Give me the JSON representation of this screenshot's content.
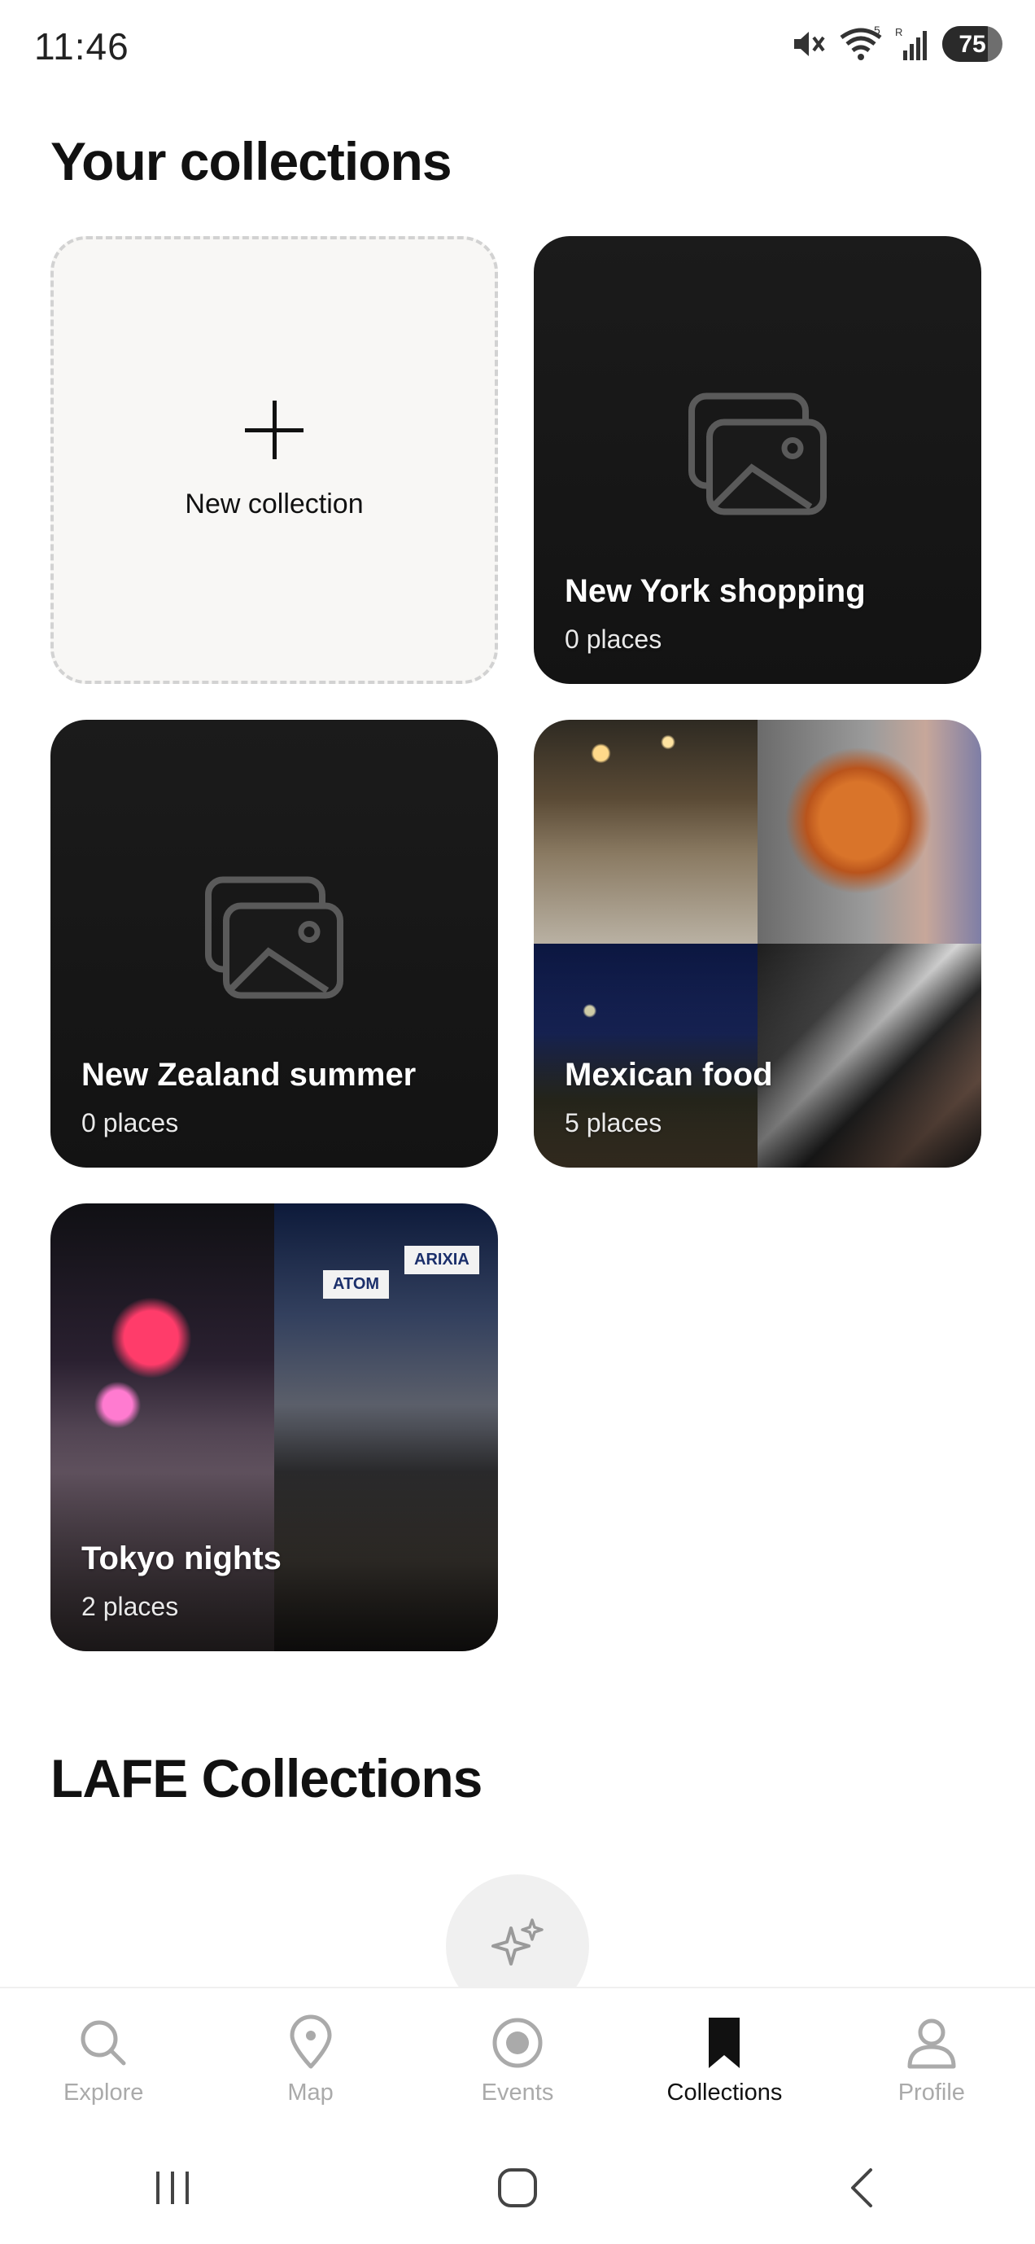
{
  "status_bar": {
    "time": "11:46",
    "battery": "75",
    "signal_label": "5",
    "roaming_label": "R"
  },
  "collections_section": {
    "title": "Your collections",
    "new_collection_label": "New collection",
    "items": [
      {
        "title": "New York shopping",
        "count": "0 places",
        "has_photos": false
      },
      {
        "title": "New Zealand summer",
        "count": "0 places",
        "has_photos": false
      },
      {
        "title": "Mexican food",
        "count": "5 places",
        "has_photos": true
      },
      {
        "title": "Tokyo nights",
        "count": "2 places",
        "has_photos": true
      }
    ],
    "tokyo_signs": [
      "ATOM",
      "ARIXIA"
    ]
  },
  "lafe_section": {
    "title": "LAFE Collections"
  },
  "bottom_nav": {
    "items": [
      {
        "label": "Explore",
        "icon": "search-icon",
        "active": false
      },
      {
        "label": "Map",
        "icon": "map-pin-icon",
        "active": false
      },
      {
        "label": "Events",
        "icon": "events-icon",
        "active": false
      },
      {
        "label": "Collections",
        "icon": "bookmark-icon",
        "active": true
      },
      {
        "label": "Profile",
        "icon": "profile-icon",
        "active": false
      }
    ]
  },
  "colors": {
    "active": "#111111",
    "inactive": "#aaaaaa",
    "card_dark": "#1b1b1b",
    "new_card_bg": "#f8f7f5"
  }
}
